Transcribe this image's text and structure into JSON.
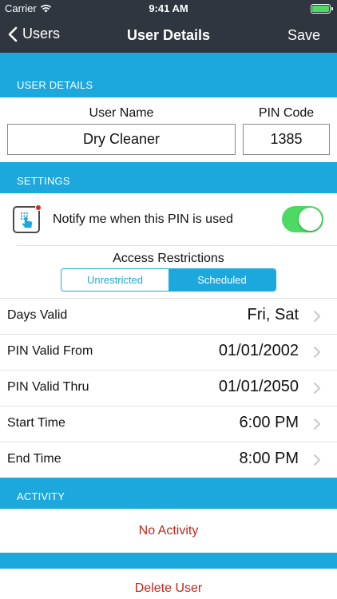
{
  "status_bar": {
    "carrier": "Carrier",
    "time": "9:41 AM"
  },
  "nav": {
    "back_label": "Users",
    "title": "User Details",
    "save_label": "Save"
  },
  "user_details": {
    "header": "USER DETAILS",
    "user_name_label": "User Name",
    "user_name_value": "Dry Cleaner",
    "pin_code_label": "PIN Code",
    "pin_code_value": "1385"
  },
  "settings": {
    "header": "SETTINGS",
    "notify_label": "Notify me when this PIN is used",
    "notify_enabled": true,
    "access_restrictions_label": "Access Restrictions",
    "segments": [
      "Unrestricted",
      "Scheduled"
    ],
    "selected_segment": "Scheduled",
    "rows": [
      {
        "label": "Days Valid",
        "value": "Fri, Sat"
      },
      {
        "label": "PIN Valid From",
        "value": "01/01/2002"
      },
      {
        "label": "PIN Valid Thru",
        "value": "01/01/2050"
      },
      {
        "label": "Start Time",
        "value": "6:00 PM"
      },
      {
        "label": "End Time",
        "value": "8:00 PM"
      }
    ]
  },
  "activity": {
    "header": "ACTIVITY",
    "empty_text": "No Activity"
  },
  "delete_label": "Delete User",
  "colors": {
    "nav_background": "#2f3640",
    "section_header": "#1ca8dd",
    "toggle_on": "#4cd964",
    "destructive_text": "#c0281c"
  }
}
